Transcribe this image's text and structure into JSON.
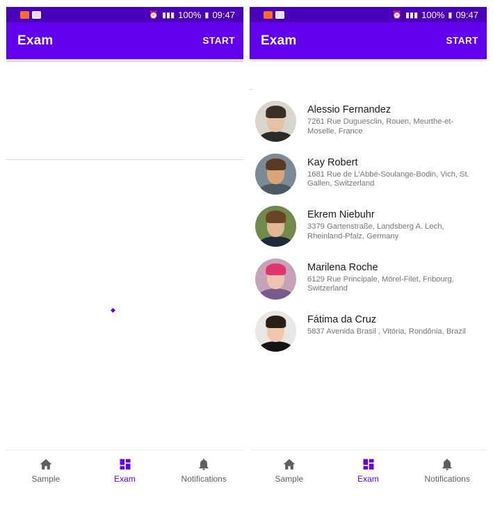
{
  "status_bar": {
    "battery": "100%",
    "time": "09:47"
  },
  "app_bar": {
    "title": "Exam",
    "action_label": "START"
  },
  "bottom_nav": {
    "items": [
      {
        "label": "Sample",
        "icon": "home-icon",
        "active": false
      },
      {
        "label": "Exam",
        "icon": "dashboard-icon",
        "active": true
      },
      {
        "label": "Notifications",
        "icon": "bell-icon",
        "active": false
      }
    ]
  },
  "colors": {
    "primary": "#6200ee",
    "status_bar": "#4a00b8",
    "nav_inactive": "#5f5f5f"
  },
  "users": [
    {
      "name": "Alessio Fernandez",
      "address": "7261 Rue Duguesclin, Rouen, Meurthe-et-Moselle, France"
    },
    {
      "name": "Kay Robert",
      "address": "1681 Rue de L'Abbé-Soulange-Bodin, Vich, St. Gallen, Switzerland"
    },
    {
      "name": "Ekrem Niebuhr",
      "address": "3379 Gartenstraße, Landsberg A. Lech, Rheinland-Pfalz, Germany"
    },
    {
      "name": "Marilena Roche",
      "address": "6129 Rue Principale, Mörel-Filet, Fribourg, Switzerland"
    },
    {
      "name": "Fátima da Cruz",
      "address": "5837 Avenida Brasil , Vitória, Rondônia, Brazil"
    }
  ]
}
